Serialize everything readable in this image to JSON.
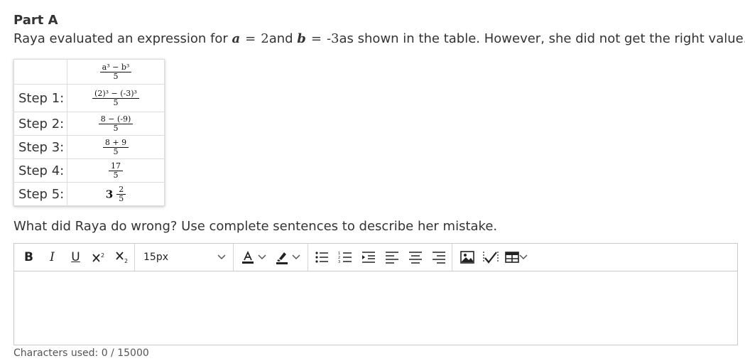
{
  "part_title": "Part A",
  "prompt": {
    "before": "Raya evaluated an expression for ",
    "var_a": "a",
    "eq1": "=",
    "val_a": "2",
    "mid": "and ",
    "var_b": "b",
    "eq2": "=",
    "val_b": "-3",
    "after": "as shown in the table. However, she did not get the right value."
  },
  "table": {
    "header": {
      "num": "a³ − b³",
      "den": "5"
    },
    "rows": [
      {
        "label": "Step 1:",
        "num": "(2)³ − (-3)³",
        "den": "5"
      },
      {
        "label": "Step 2:",
        "num": "8 − (-9)",
        "den": "5"
      },
      {
        "label": "Step 3:",
        "num": "8 + 9",
        "den": "5"
      },
      {
        "label": "Step 4:",
        "num": "17",
        "den": "5"
      },
      {
        "label": "Step 5:",
        "whole": "3",
        "num": "2",
        "den": "5"
      }
    ]
  },
  "question": "What did Raya do wrong? Use complete sentences to describe her mistake.",
  "toolbar": {
    "bold": "B",
    "italic": "I",
    "underline": "U",
    "font_size": "15px"
  },
  "char_count": "Characters used: 0 / 15000"
}
